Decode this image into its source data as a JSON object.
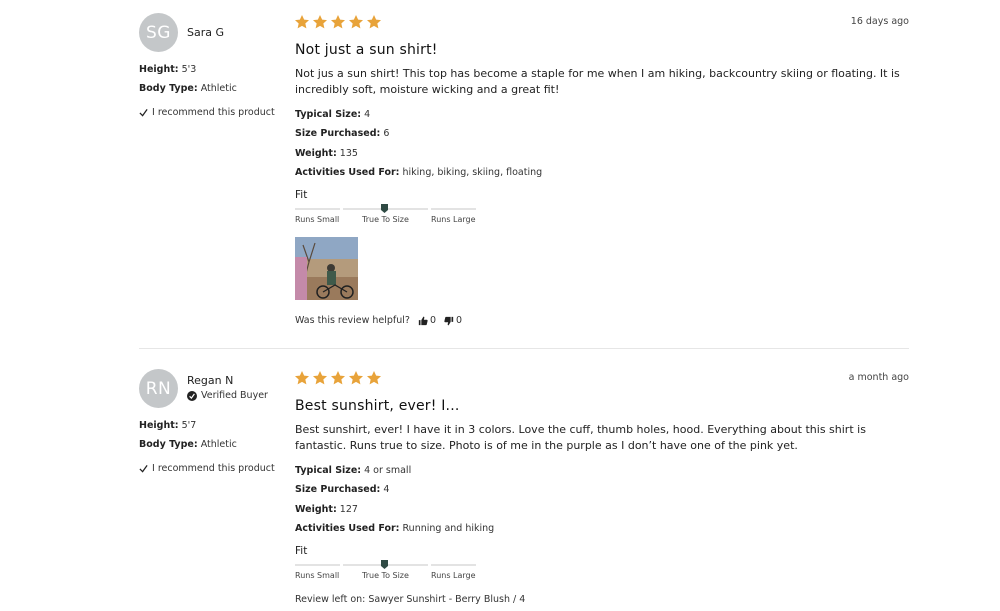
{
  "reviews": [
    {
      "initials": "SG",
      "name": "Sara G",
      "verified_label": "",
      "height_label": "Height:",
      "height": "5'3",
      "body_label": "Body Type:",
      "body": "Athletic",
      "recommend": "I recommend this product",
      "rating": 5,
      "date": "16 days ago",
      "title": "Not just a sun shirt!",
      "text": "Not jus a sun shirt! This top has become a staple for me when I am hiking, backcountry skiing or floating. It is incredibly soft, moisture wicking and a great fit!",
      "typical_size_label": "Typical Size:",
      "typical_size": "4",
      "size_purchased_label": "Size Purchased:",
      "size_purchased": "6",
      "weight_label": "Weight:",
      "weight": "135",
      "activities_label": "Activities Used For:",
      "activities": "hiking, biking, skiing, floating",
      "fit_label": "Fit",
      "fit_small": "Runs Small",
      "fit_true": "True To Size",
      "fit_large": "Runs Large",
      "fit_value": 0.5,
      "helpful_label": "Was this review helpful?",
      "helpful_yes": "0",
      "helpful_no": "0"
    },
    {
      "initials": "RN",
      "name": "Regan N",
      "verified_label": "Verified Buyer",
      "height_label": "Height:",
      "height": "5'7",
      "body_label": "Body Type:",
      "body": "Athletic",
      "recommend": "I recommend this product",
      "rating": 5,
      "date": "a month ago",
      "title": "Best sunshirt, ever! I...",
      "text": "Best sunshirt, ever! I have it in 3 colors. Love the cuff, thumb holes, hood. Everything about this shirt is fantastic. Runs true to size. Photo is of me in the purple as I don’t have one of the pink yet.",
      "typical_size_label": "Typical Size:",
      "typical_size": "4 or small",
      "size_purchased_label": "Size Purchased:",
      "size_purchased": "4",
      "weight_label": "Weight:",
      "weight": "127",
      "activities_label": "Activities Used For:",
      "activities": "Running and hiking",
      "fit_label": "Fit",
      "fit_small": "Runs Small",
      "fit_true": "True To Size",
      "fit_large": "Runs Large",
      "fit_value": 0.5,
      "review_left_on": "Review left on: Sawyer Sunshirt - Berry Blush / 4"
    }
  ],
  "colors": {
    "star": "#e8a33a",
    "avatar": "#c4c7c9",
    "fit_marker": "#2f4a44"
  },
  "icons": {
    "star": "star-icon",
    "check": "check-icon",
    "verified": "verified-check-icon",
    "thumbs_up": "thumbs-up-icon",
    "thumbs_down": "thumbs-down-icon"
  }
}
